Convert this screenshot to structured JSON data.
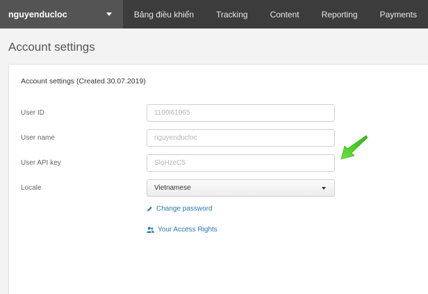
{
  "topnav": {
    "account_name": "nguyenducloc",
    "items": [
      {
        "label": "Bảng điều khiển"
      },
      {
        "label": "Tracking"
      },
      {
        "label": "Content"
      },
      {
        "label": "Reporting"
      },
      {
        "label": "Payments"
      }
    ]
  },
  "page": {
    "title": "Account settings"
  },
  "panel": {
    "heading": "Account settings (Created 30.07.2019)",
    "fields": {
      "user_id": {
        "label": "User ID",
        "value": "1100l61065"
      },
      "user_name": {
        "label": "User name",
        "value": "nguyenducloc"
      },
      "api_key": {
        "label": "User API key",
        "value": "SloHzeC5"
      },
      "locale": {
        "label": "Locale",
        "value": "Vietnamese"
      }
    },
    "links": {
      "change_password": "Change password",
      "access_rights": "Your Access Rights"
    }
  },
  "colors": {
    "nav_bg": "#3c3c3c",
    "account_bg": "#545454",
    "link": "#2a7ab0",
    "annotation_arrow": "#3fcf1e"
  },
  "icons": {
    "account_caret": "chevron-down-icon",
    "locale_caret": "chevron-down-icon",
    "change_password": "pencil-icon",
    "access_rights": "users-icon",
    "annotation": "arrow-icon"
  }
}
